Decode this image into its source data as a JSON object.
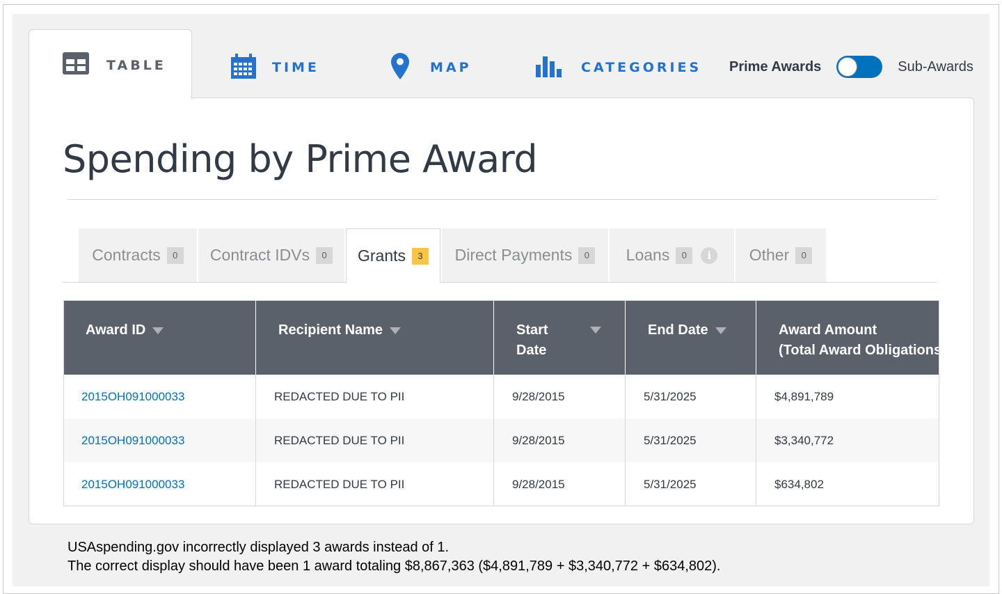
{
  "view_tabs": {
    "table": "TABLE",
    "time": "TIME",
    "map": "MAP",
    "categories": "CATEGORIES"
  },
  "award_toggle": {
    "prime_label": "Prime Awards",
    "sub_label": "Sub-Awards",
    "state": "prime"
  },
  "page_title": "Spending by Prime Award",
  "award_types": [
    {
      "label": "Contracts",
      "count": "0"
    },
    {
      "label": "Contract IDVs",
      "count": "0"
    },
    {
      "label": "Grants",
      "count": "3"
    },
    {
      "label": "Direct Payments",
      "count": "0"
    },
    {
      "label": "Loans",
      "count": "0"
    },
    {
      "label": "Other",
      "count": "0"
    }
  ],
  "active_award_type": "Grants",
  "table": {
    "headers": {
      "award_id": "Award ID",
      "recipient": "Recipient Name",
      "start_line1": "Start",
      "start_line2": "Date",
      "end_date": "End Date",
      "amount_line1": "Award Amount",
      "amount_line2": "(Total Award Obligations)"
    },
    "rows": [
      {
        "award_id": "2015OH091000033",
        "recipient": "REDACTED DUE TO PII",
        "start": "9/28/2015",
        "end": "5/31/2025",
        "amount": "$4,891,789"
      },
      {
        "award_id": "2015OH091000033",
        "recipient": "REDACTED DUE TO PII",
        "start": "9/28/2015",
        "end": "5/31/2025",
        "amount": "$3,340,772"
      },
      {
        "award_id": "2015OH091000033",
        "recipient": "REDACTED DUE TO PII",
        "start": "9/28/2015",
        "end": "5/31/2025",
        "amount": "$634,802"
      }
    ]
  },
  "caption": {
    "line1": "USAspending.gov incorrectly displayed 3 awards instead of 1.",
    "line2": "The correct display should have been 1 award totaling $8,867,363 ($4,891,789 + $3,340,772 + $634,802)."
  },
  "colors": {
    "accent_blue": "#0071bc",
    "header_gray": "#5b616b",
    "badge_yellow": "#f9c642"
  },
  "icons": [
    "table-icon",
    "calendar-icon",
    "map-pin-icon",
    "bar-chart-icon",
    "info-icon",
    "sort-down-icon"
  ]
}
